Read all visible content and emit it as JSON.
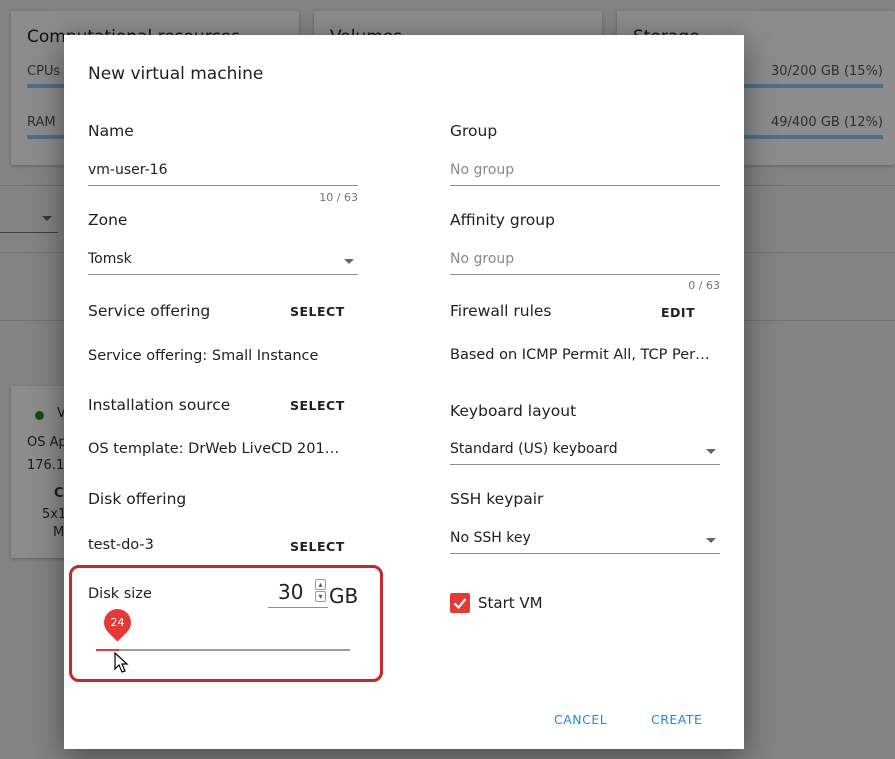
{
  "background": {
    "cards": [
      {
        "title": "Computational resources",
        "rows": [
          {
            "label": "CPUs"
          },
          {
            "label": "RAM"
          }
        ]
      },
      {
        "title": "Volumes"
      },
      {
        "title": "Storage",
        "rows": [
          {
            "value": "30/200 GB (15%)"
          },
          {
            "value": "49/400 GB (12%)"
          }
        ]
      }
    ],
    "vm_card": {
      "status_color": "#2e7d32",
      "name": "V",
      "os": "OS Ap",
      "ip": "176.1",
      "line_c": "C",
      "line_5": "5x1",
      "line_m": "M"
    }
  },
  "dialog": {
    "title": "New virtual machine",
    "left": {
      "name_label": "Name",
      "name_value": "vm-user-16",
      "name_counter": "10 / 63",
      "zone_label": "Zone",
      "zone_value": "Tomsk",
      "service_offering_label": "Service offering",
      "service_offering_button": "SELECT",
      "service_offering_value": "Service offering: Small Instance",
      "installation_source_label": "Installation source",
      "installation_source_button": "SELECT",
      "installation_source_value": "OS template: DrWeb LiveCD 201…",
      "disk_offering_label": "Disk offering",
      "disk_offering_value": "test-do-3",
      "disk_offering_button": "SELECT",
      "disk_size_label": "Disk size",
      "disk_size_value": "30",
      "disk_size_unit": "GB",
      "disk_slider_value": "24",
      "disk_slider_fraction": 0.09
    },
    "right": {
      "group_label": "Group",
      "group_placeholder": "No group",
      "affinity_label": "Affinity group",
      "affinity_placeholder": "No group",
      "affinity_counter": "0 / 63",
      "firewall_label": "Firewall rules",
      "firewall_button": "EDIT",
      "firewall_value": "Based on ICMP Permit All, TCP Per…",
      "keyboard_label": "Keyboard layout",
      "keyboard_value": "Standard (US) keyboard",
      "ssh_label": "SSH keypair",
      "ssh_value": "No SSH key",
      "start_vm_label": "Start VM",
      "start_vm_checked": true
    },
    "actions": {
      "cancel": "CANCEL",
      "create": "CREATE"
    },
    "colors": {
      "accent": "#e53935",
      "primary": "#1e88e5",
      "highlight": "#c62828"
    }
  }
}
